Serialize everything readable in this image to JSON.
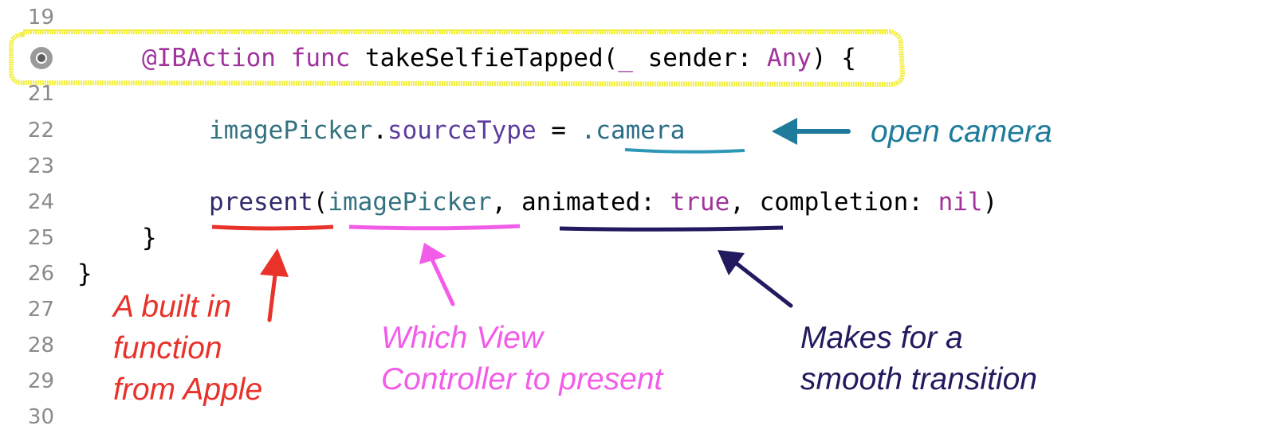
{
  "gutter": {
    "lines": [
      "19",
      "21",
      "22",
      "23",
      "24",
      "25",
      "26",
      "27",
      "28",
      "29",
      "30"
    ]
  },
  "code": {
    "line20": {
      "attr": "@IBAction",
      "kw_func": "func",
      "name": "takeSelfieTapped(",
      "underscore": "_",
      "param": " sender: ",
      "type": "Any",
      "close": ") {"
    },
    "line22": {
      "obj": "imagePicker",
      "dot": ".",
      "prop": "sourceType",
      "eq": " = ",
      "value": ".camera"
    },
    "line24": {
      "fn": "present",
      "open": "(",
      "arg": "imagePicker",
      "comma1": ", ",
      "label": "animated: ",
      "bool": "true",
      "comma2": ", completion: ",
      "nil": "nil",
      "close": ")"
    },
    "line25": "}",
    "line26": "}"
  },
  "annotations": {
    "camera_note": "open camera",
    "present_note": [
      "A built in",
      "function",
      "from Apple"
    ],
    "picker_note": [
      "Which View",
      "Controller to present"
    ],
    "animated_note": [
      "Makes for a",
      "smooth transition"
    ]
  },
  "colors": {
    "highlight": "#f2ee3a",
    "teal": "#1e7b9b",
    "red": "#e8322a",
    "magenta": "#f25ce8",
    "navy": "#211a5e"
  }
}
